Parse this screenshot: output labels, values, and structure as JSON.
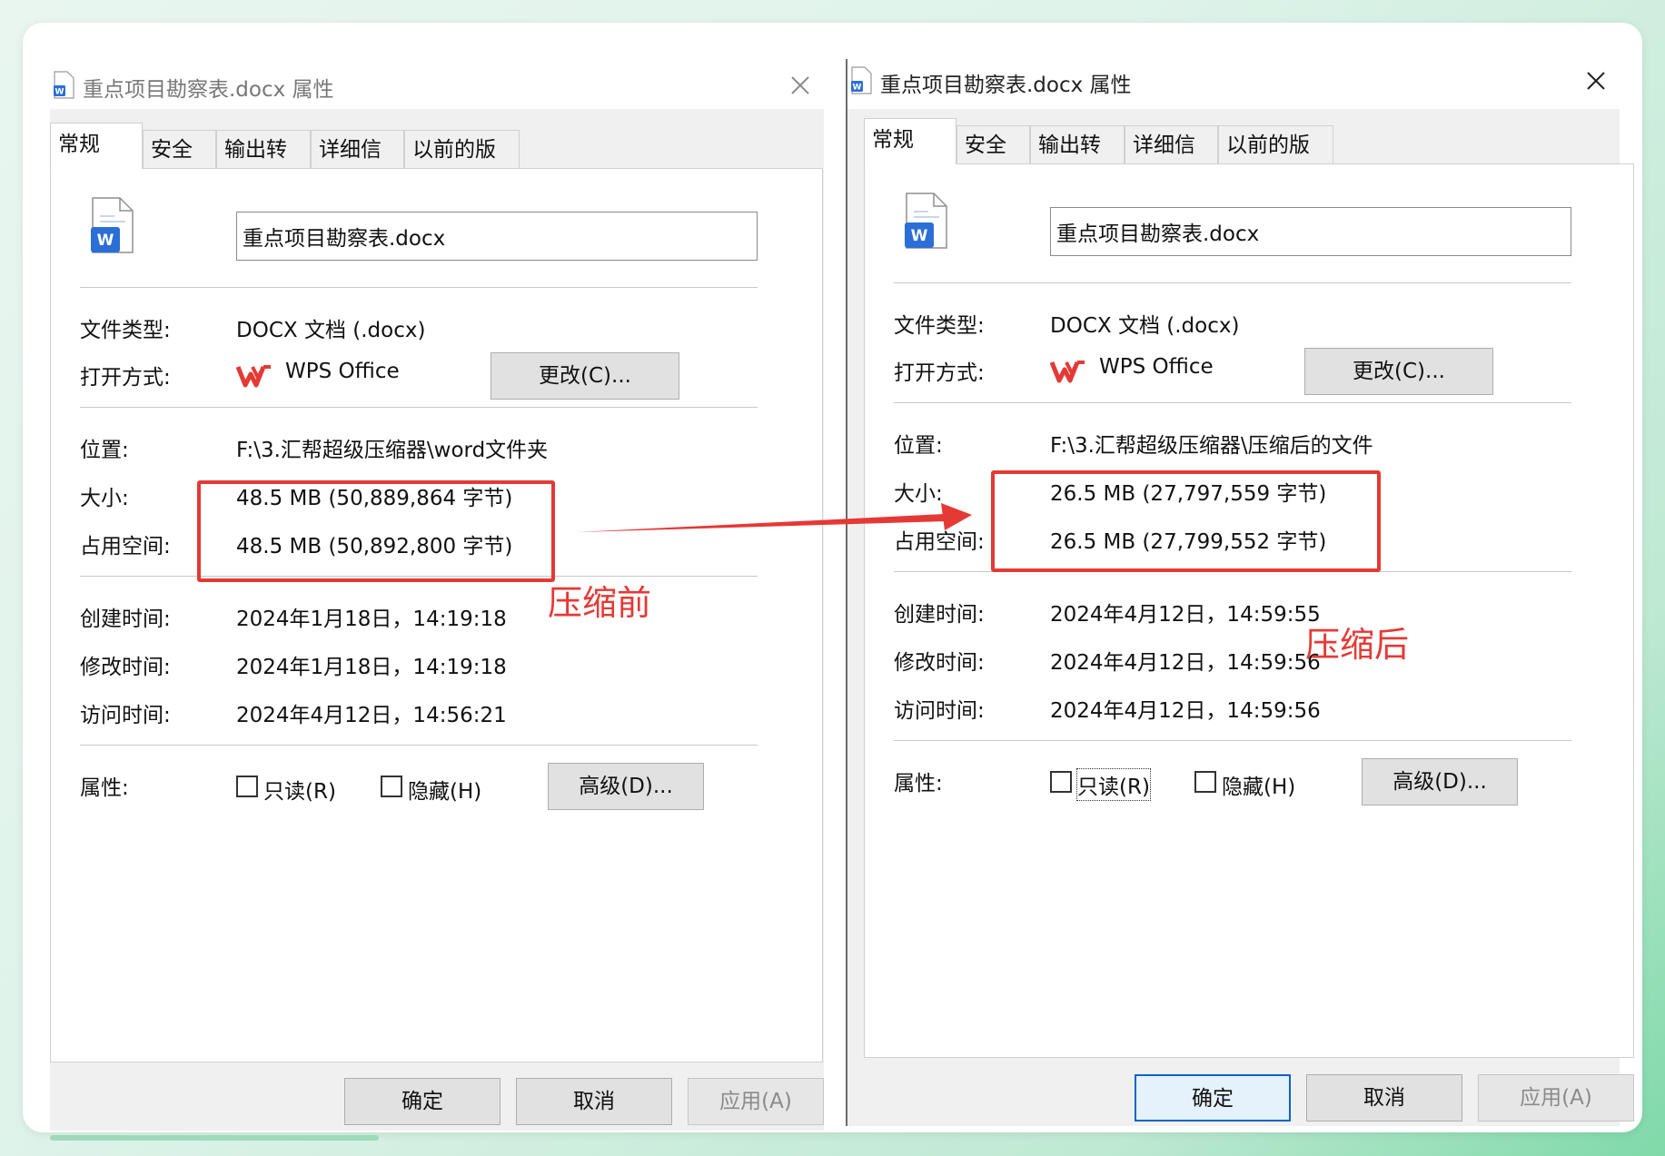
{
  "colors": {
    "annotation": "#e53935",
    "accent": "#0a64c8",
    "word_blue": "#2b6fd6",
    "wps_red": "#e53935"
  },
  "icons": {
    "title": "word-doc-icon",
    "close": "close-icon",
    "file": "word-doc-icon",
    "app": "wps-office-icon"
  },
  "left": {
    "title": "重点项目勘察表.docx 属性",
    "tabs": [
      "常规",
      "安全",
      "输出转换",
      "详细信息",
      "以前的版本"
    ],
    "file_name": "重点项目勘察表.docx",
    "labels": {
      "type": "文件类型:",
      "open_with": "打开方式:",
      "location": "位置:",
      "size": "大小:",
      "disk_size": "占用空间:",
      "created": "创建时间:",
      "modified": "修改时间:",
      "accessed": "访问时间:",
      "attributes": "属性:"
    },
    "values": {
      "type": "DOCX 文档 (.docx)",
      "open_with": "WPS Office",
      "location": "F:\\3.汇帮超级压缩器\\word文件夹",
      "size": "48.5 MB (50,889,864 字节)",
      "disk_size": "48.5 MB (50,892,800 字节)",
      "created": "2024年1月18日，14:19:18",
      "modified": "2024年1月18日，14:19:18",
      "accessed": "2024年4月12日，14:56:21"
    },
    "buttons": {
      "change": "更改(C)...",
      "advanced": "高级(D)...",
      "ok": "确定",
      "cancel": "取消",
      "apply": "应用(A)"
    },
    "checkboxes": {
      "readonly": "只读(R)",
      "hidden": "隐藏(H)"
    },
    "annotation": "压缩前"
  },
  "right": {
    "title": "重点项目勘察表.docx 属性",
    "tabs": [
      "常规",
      "安全",
      "输出转换",
      "详细信息",
      "以前的版本"
    ],
    "file_name": "重点项目勘察表.docx",
    "labels": {
      "type": "文件类型:",
      "open_with": "打开方式:",
      "location": "位置:",
      "size": "大小:",
      "disk_size": "占用空间:",
      "created": "创建时间:",
      "modified": "修改时间:",
      "accessed": "访问时间:",
      "attributes": "属性:"
    },
    "values": {
      "type": "DOCX 文档 (.docx)",
      "open_with": "WPS Office",
      "location": "F:\\3.汇帮超级压缩器\\压缩后的文件",
      "size": "26.5 MB (27,797,559 字节)",
      "disk_size": "26.5 MB (27,799,552 字节)",
      "created": "2024年4月12日，14:59:55",
      "modified": "2024年4月12日，14:59:56",
      "accessed": "2024年4月12日，14:59:56"
    },
    "buttons": {
      "change": "更改(C)...",
      "advanced": "高级(D)...",
      "ok": "确定",
      "cancel": "取消",
      "apply": "应用(A)"
    },
    "checkboxes": {
      "readonly": "只读(R)",
      "hidden": "隐藏(H)"
    },
    "annotation": "压缩后"
  }
}
